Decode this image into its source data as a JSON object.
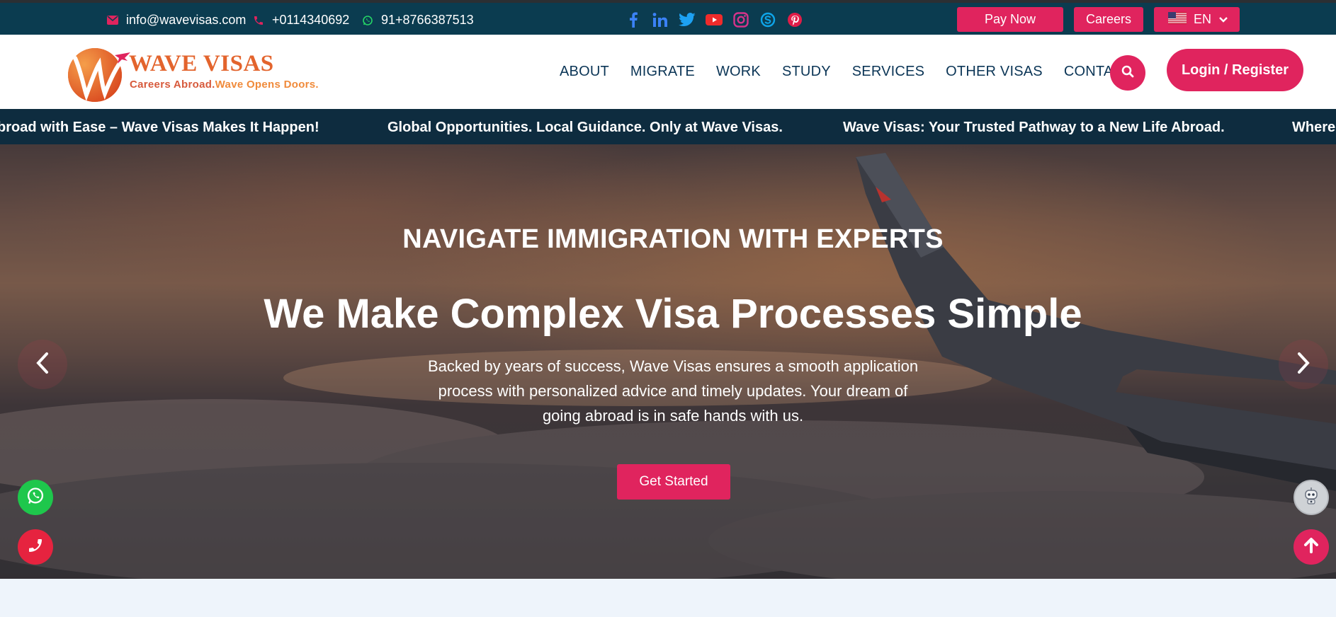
{
  "topbar": {
    "email": "info@wavevisas.com",
    "phone": "+0114340692",
    "whatsapp": "91+8766387513",
    "social_icons": [
      "facebook-icon",
      "linkedin-icon",
      "twitter-icon",
      "youtube-icon",
      "instagram-icon",
      "skype-icon",
      "pinterest-icon"
    ],
    "pay_now": "Pay Now",
    "careers": "Careers",
    "language": "EN"
  },
  "header": {
    "logo_title": "WAVE VISAS",
    "logo_tag_a": "Careers Abroad.",
    "logo_tag_b": "Wave Opens Doors.",
    "nav": [
      "ABOUT",
      "MIGRATE",
      "WORK",
      "STUDY",
      "SERVICES",
      "OTHER VISAS",
      "CONTACT"
    ],
    "login": "Login / Register"
  },
  "ticker": [
    "broad with Ease – Wave Visas Makes It Happen!",
    "Global Opportunities. Local Guidance. Only at Wave Visas.",
    "Wave Visas: Your Trusted Pathway to a New Life Abroad.",
    "Where"
  ],
  "hero": {
    "kicker": "NAVIGATE IMMIGRATION WITH EXPERTS",
    "headline": "We Make Complex Visa Processes Simple",
    "subtext": "Backed by years of success, Wave Visas ensures a smooth application process with personalized advice and timely updates. Your dream of going abroad is in safe hands with us.",
    "cta": "Get Started"
  },
  "colors": {
    "accent": "#e0245e",
    "topbar_bg": "#0b3c50",
    "ticker_bg": "#0e2c3f",
    "nav_text": "#0b3556",
    "logo_orange": "#e3642d"
  }
}
